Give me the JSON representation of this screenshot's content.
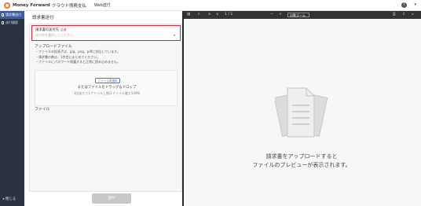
{
  "header": {
    "brand": "Money Forward",
    "product": "クラウド債務支払",
    "mode": "Web送付",
    "help_icon": "question-circle-icon",
    "help_glyph": "?",
    "user_icon": "caret-down-icon",
    "user_glyph": "▾"
  },
  "sidebar": {
    "items": [
      {
        "label": "請求書送付",
        "active": true
      },
      {
        "label": "送付履歴",
        "active": false
      }
    ],
    "collapse_label": "◂ 閉じる"
  },
  "page": {
    "title": "請求書送付"
  },
  "form": {
    "recipient_label": "請求書の送付先",
    "required_badge": "必須",
    "recipient_placeholder": "送付先を選択してください",
    "upload_title": "アップロードファイル",
    "notes": [
      "・ファイルの拡張子は、jpg、png、pdfに対応しています。",
      "・請求書の数は、1件目にまとめてください。",
      "・ファイルにパスワード保護すると正常に読み込めません。"
    ],
    "select_file_button": "ファイル再選択",
    "drop_text": "またはファイルをドラッグ＆ドロップ",
    "drop_limit": "1回あたり1ファイル上限/1ファイル最大50MB",
    "file_section_label": "ファイル",
    "send_button": "送付"
  },
  "viewer": {
    "page_indicator": "1 / 1",
    "zoom_label": "自動ズーム",
    "preview_line1": "請求書をアップロードすると",
    "preview_line2": "ファイルのプレビューが表示されます。"
  },
  "colors": {
    "sidebar_bg": "#2b3240",
    "sidebar_active": "#3d5f9e",
    "required_red": "#d8283f",
    "link_blue": "#3b7ad9",
    "viewer_toolbar": "#333333",
    "brand_orange": "#ef7d22"
  }
}
